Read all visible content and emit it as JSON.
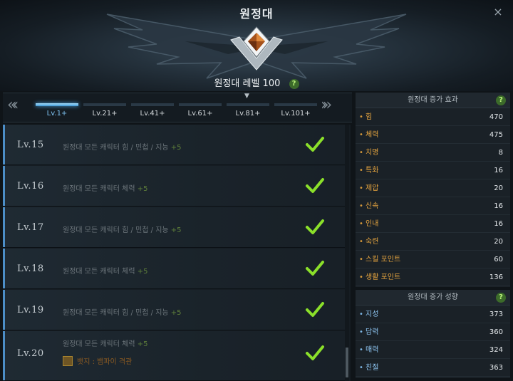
{
  "header": {
    "title": "원정대",
    "level_text": "원정대 레벨 100",
    "help_glyph": "?",
    "close_glyph": "×"
  },
  "tabs": {
    "prev_glyph": "«‹",
    "next_glyph": "›»",
    "active_index": 0,
    "items": [
      {
        "label": "Lv.1+"
      },
      {
        "label": "Lv.21+"
      },
      {
        "label": "Lv.41+"
      },
      {
        "label": "Lv.61+"
      },
      {
        "label": "Lv.81+"
      },
      {
        "label": "Lv.101+"
      }
    ]
  },
  "levels": [
    {
      "lv": "Lv.15",
      "desc": "원정대 모든 캐릭터 힘 / 민첩 / 지능",
      "bonus": "+5"
    },
    {
      "lv": "Lv.16",
      "desc": "원정대 모든 캐릭터 체력",
      "bonus": "+5"
    },
    {
      "lv": "Lv.17",
      "desc": "원정대 모든 캐릭터 힘 / 민첩 / 지능",
      "bonus": "+5"
    },
    {
      "lv": "Lv.18",
      "desc": "원정대 모든 캐릭터 체력",
      "bonus": "+5"
    },
    {
      "lv": "Lv.19",
      "desc": "원정대 모든 캐릭터 힘 / 민첩 / 지능",
      "bonus": "+5"
    },
    {
      "lv": "Lv.20",
      "desc": "원정대 모든 캐릭터 체력",
      "bonus": "+5",
      "reward": "뱃지 : 뱀파이 격관"
    }
  ],
  "effects_panel": {
    "title": "원정대 증가 효과",
    "stats": [
      {
        "name": "힘",
        "value": "470"
      },
      {
        "name": "체력",
        "value": "475"
      },
      {
        "name": "치명",
        "value": "8"
      },
      {
        "name": "특화",
        "value": "16"
      },
      {
        "name": "제압",
        "value": "20"
      },
      {
        "name": "신속",
        "value": "16"
      },
      {
        "name": "인내",
        "value": "16"
      },
      {
        "name": "숙련",
        "value": "20"
      },
      {
        "name": "스킬 포인트",
        "value": "60"
      },
      {
        "name": "생활 포인트",
        "value": "136"
      }
    ]
  },
  "traits_panel": {
    "title": "원정대 증가 성향",
    "stats": [
      {
        "name": "지성",
        "value": "373"
      },
      {
        "name": "담력",
        "value": "360"
      },
      {
        "name": "매력",
        "value": "324"
      },
      {
        "name": "친절",
        "value": "363"
      }
    ]
  },
  "colors": {
    "accent_blue": "#4aa8e8",
    "check_green": "#8be02a",
    "effect_orange": "#e8a63f",
    "trait_blue": "#8fc6f3"
  },
  "icons": {
    "emblem": "diamond-emblem-icon",
    "check": "checkmark-icon",
    "close": "close-icon",
    "help": "help-icon"
  }
}
